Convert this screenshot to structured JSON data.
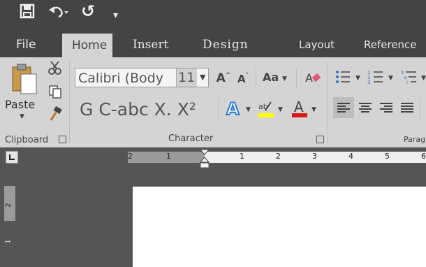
{
  "quick_access": {
    "redo_glyph": "↺",
    "more_glyph": "▾"
  },
  "tabs": {
    "file": "File",
    "home": "Home",
    "insert": "Insert",
    "design": "Design",
    "layout": "Layout",
    "references": "Reference"
  },
  "clipboard": {
    "paste_label": "Paste",
    "group_label": "Clipboard"
  },
  "character": {
    "font_name": "Calibri (Body",
    "font_size": "11",
    "group_label": "Character",
    "change_case": "Aa",
    "strikethrough_text": "G C-abc X. X²"
  },
  "paragraph": {
    "group_label": "Parag"
  },
  "ruler": {
    "labels": [
      "2",
      "1",
      "1",
      "2",
      "3",
      "4",
      "5",
      "6"
    ],
    "vertical_labels": [
      "2",
      "1"
    ]
  },
  "colors": {
    "title_bg": "#444444",
    "ribbon_bg": "#d4d4d4",
    "highlight_yellow": "#ffff00",
    "font_color_red": "#d61b1b",
    "text_effect_blue": "#2b7bd8"
  }
}
